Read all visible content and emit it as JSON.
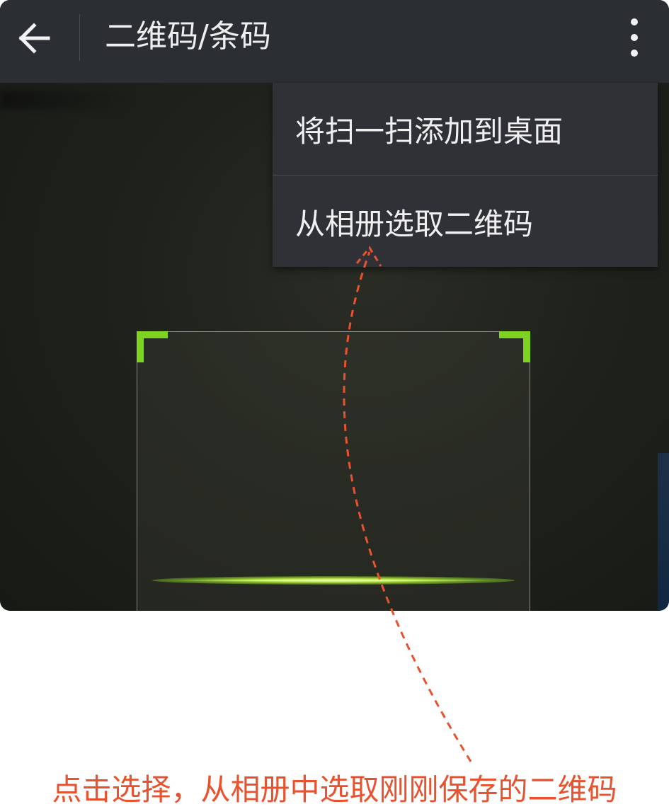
{
  "header": {
    "title": "二维码/条码",
    "back_icon": "arrow-left-icon",
    "more_icon": "more-vertical-icon"
  },
  "menu": {
    "items": [
      {
        "label": "将扫一扫添加到桌面"
      },
      {
        "label": "从相册选取二维码"
      }
    ]
  },
  "scanner": {
    "accent_color": "#7ed321"
  },
  "annotation": {
    "caption": "点击选择，从相册中选取刚刚保存的二维码",
    "color": "#e8522f"
  }
}
